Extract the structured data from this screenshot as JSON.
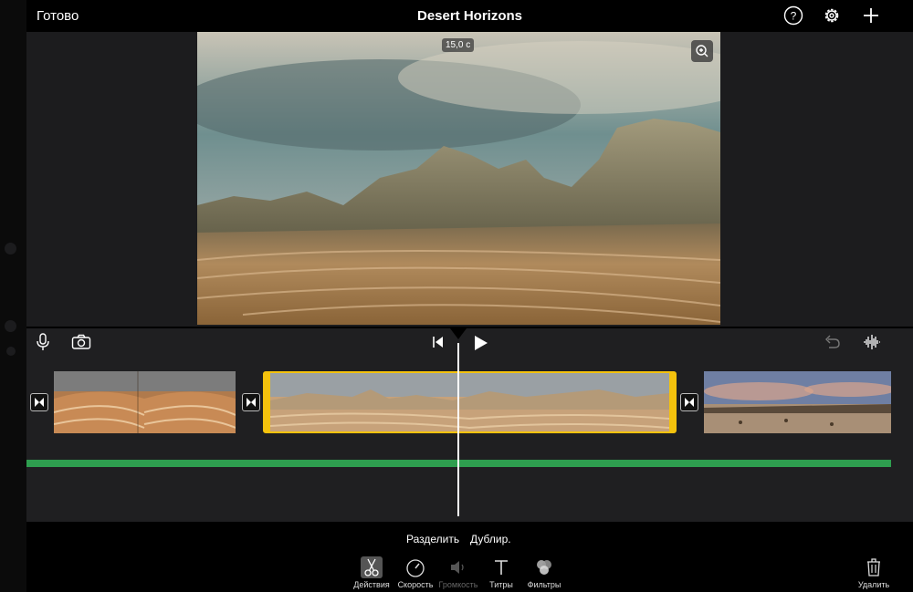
{
  "header": {
    "done_label": "Готово",
    "title": "Desert Horizons",
    "icons": [
      "help-icon",
      "settings-gear-icon",
      "add-plus-icon"
    ]
  },
  "preview": {
    "duration_badge": "15,0 с",
    "zoom_icon": "zoom-in-icon"
  },
  "timeline": {
    "left_icons": [
      "microphone-icon",
      "camera-icon"
    ],
    "center_icons": [
      "skip-to-start-icon",
      "play-icon"
    ],
    "right_icons": [
      "undo-icon",
      "audio-waveform-icon"
    ],
    "clips": [
      {
        "name": "clip-1",
        "selected": false
      },
      {
        "name": "clip-2",
        "selected": true
      },
      {
        "name": "clip-3",
        "selected": false
      }
    ],
    "colors": {
      "selection": "#f4c20d",
      "audio_track": "#2e9e4f",
      "playhead": "#ffffff"
    }
  },
  "actions": {
    "split_label": "Разделить",
    "duplicate_label": "Дублир."
  },
  "tools": [
    {
      "label": "Действия",
      "icon": "scissors-icon",
      "active": true,
      "enabled": true
    },
    {
      "label": "Скорость",
      "icon": "speedometer-icon",
      "active": false,
      "enabled": true
    },
    {
      "label": "Громкость",
      "icon": "speaker-icon",
      "active": false,
      "enabled": false
    },
    {
      "label": "Титры",
      "icon": "text-titles-icon",
      "active": false,
      "enabled": true
    },
    {
      "label": "Фильтры",
      "icon": "filters-icon",
      "active": false,
      "enabled": true
    }
  ],
  "delete_label": "Удалить"
}
